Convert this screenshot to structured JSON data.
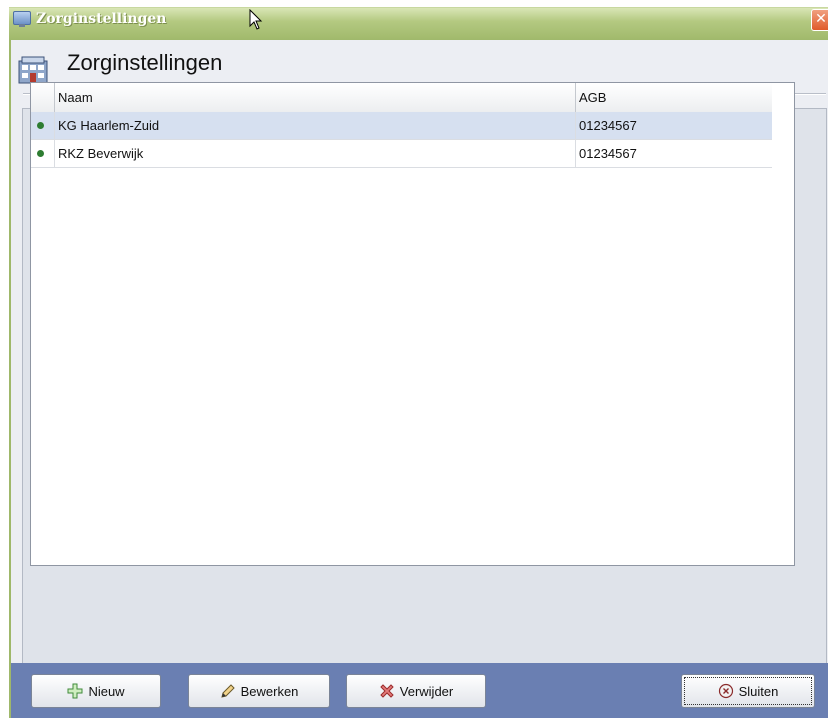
{
  "window": {
    "title": "Zorginstellingen",
    "close_symbol": "✕"
  },
  "header": {
    "title": "Zorginstellingen",
    "icon": "building-icon"
  },
  "table": {
    "columns": [
      "Naam",
      "AGB"
    ],
    "rows": [
      {
        "naam": "KG Haarlem-Zuid",
        "agb": "01234567",
        "status": "active",
        "selected": true
      },
      {
        "naam": "RKZ Beverwijk",
        "agb": "01234567",
        "status": "active",
        "selected": false
      }
    ],
    "status_color": "#2e7d32"
  },
  "buttons": {
    "new": {
      "label": "Nieuw",
      "icon": "plus-icon"
    },
    "edit": {
      "label": "Bewerken",
      "icon": "pencil-icon"
    },
    "delete": {
      "label": "Verwijder",
      "icon": "cross-icon"
    },
    "close": {
      "label": "Sluiten",
      "icon": "close-circle-icon"
    }
  },
  "colors": {
    "titlebar": "#b4c981",
    "footer": "#6a7fb2",
    "selected_row": "#d6e0f0"
  }
}
